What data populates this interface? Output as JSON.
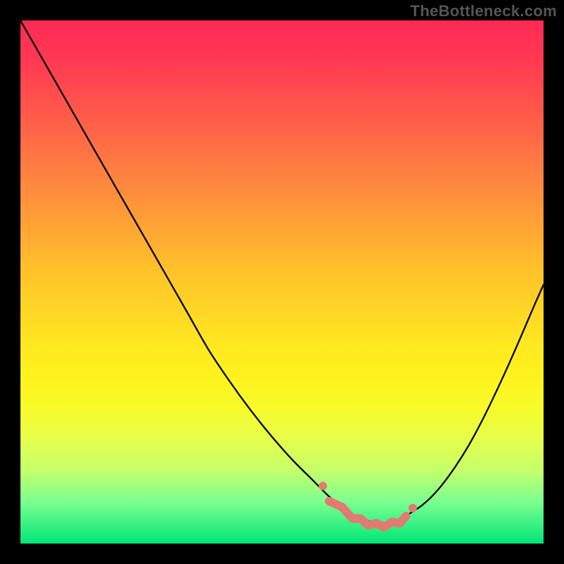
{
  "watermark": {
    "text": "TheBottleneck.com"
  },
  "chart_data": {
    "type": "line",
    "title": "",
    "xlabel": "",
    "ylabel": "",
    "xlim": [
      0,
      100
    ],
    "ylim": [
      0,
      100
    ],
    "series": [
      {
        "name": "curve",
        "x": [
          0,
          4,
          8,
          12,
          16,
          20,
          24,
          28,
          32,
          36,
          40,
          44,
          48,
          52,
          56,
          59,
          62,
          64,
          66,
          68,
          70,
          72,
          74,
          77,
          80,
          83,
          86,
          89,
          92,
          95,
          98,
          100
        ],
        "y_pct_from_top": [
          0,
          7,
          14,
          21,
          28,
          35,
          42,
          49,
          56,
          63,
          69,
          74.5,
          79.5,
          84,
          88,
          91,
          93.3,
          94.7,
          95.5,
          96,
          96,
          95.5,
          94.5,
          92.5,
          89.5,
          85.5,
          80.7,
          75,
          68.7,
          62,
          55,
          50.5
        ]
      }
    ],
    "markers": {
      "name": "bottom-salmon-markers",
      "color": "#e17b72",
      "points_x_pct": [
        59,
        61.5,
        63.5,
        65,
        66.5,
        68,
        69.5,
        71,
        72.5,
        73.7
      ]
    }
  }
}
